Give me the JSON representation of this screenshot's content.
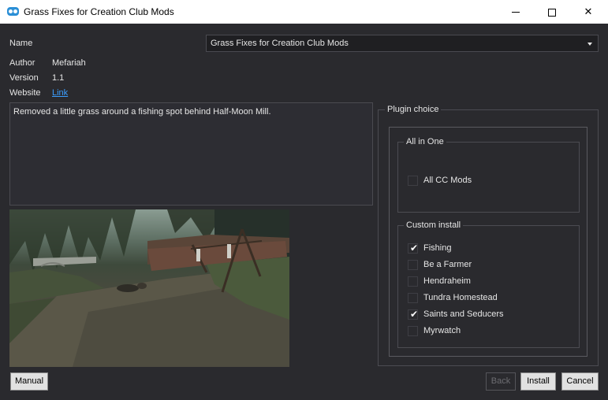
{
  "window": {
    "title": "Grass Fixes for Creation Club Mods"
  },
  "info": {
    "name_label": "Name",
    "name_value": "Grass Fixes for Creation Club Mods",
    "author_label": "Author",
    "author_value": "Mefariah",
    "version_label": "Version",
    "version_value": "1.1",
    "website_label": "Website",
    "website_link": "Link"
  },
  "description": "Removed a little grass around a fishing spot behind Half-Moon Mill.",
  "plugin": {
    "group_title": "Plugin choice",
    "all_in_one": {
      "title": "All in One",
      "options": [
        {
          "label": "All CC Mods",
          "checked": false
        }
      ]
    },
    "custom": {
      "title": "Custom install",
      "options": [
        {
          "label": "Fishing",
          "checked": true
        },
        {
          "label": "Be a Farmer",
          "checked": false
        },
        {
          "label": "Hendraheim",
          "checked": false
        },
        {
          "label": "Tundra Homestead",
          "checked": false
        },
        {
          "label": "Saints and Seducers",
          "checked": true
        },
        {
          "label": "Myrwatch",
          "checked": false
        }
      ]
    }
  },
  "buttons": {
    "manual": "Manual",
    "back": "Back",
    "install": "Install",
    "cancel": "Cancel"
  },
  "check_glyph": "✔"
}
